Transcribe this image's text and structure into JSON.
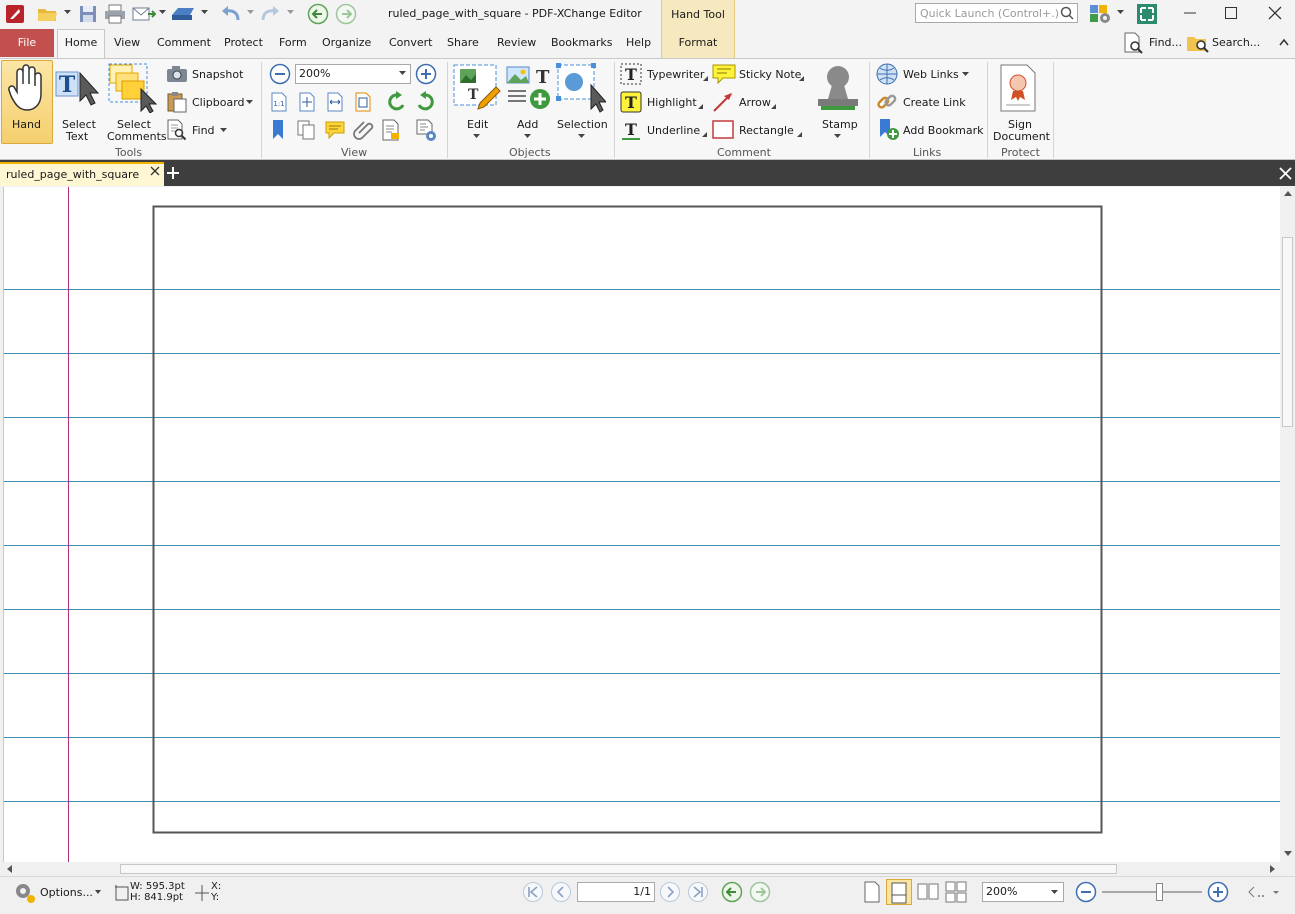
{
  "titlebar": {
    "title": "ruled_page_with_square - PDF-XChange Editor",
    "context_tab": "Hand Tool",
    "quick_launch_placeholder": "Quick Launch (Control+.)"
  },
  "menu": {
    "file": "File",
    "tabs": [
      "Home",
      "View",
      "Comment",
      "Protect",
      "Form",
      "Organize",
      "Convert",
      "Share",
      "Review",
      "Bookmarks",
      "Help"
    ],
    "context_format": "Format",
    "find": "Find...",
    "search": "Search..."
  },
  "ribbon": {
    "tools": {
      "group": "Tools",
      "hand": "Hand",
      "select_text_1": "Select",
      "select_text_2": "Text",
      "select_comments_1": "Select",
      "select_comments_2": "Comments",
      "snapshot": "Snapshot",
      "clipboard": "Clipboard",
      "find": "Find"
    },
    "view": {
      "group": "View",
      "zoom": "200%"
    },
    "objects": {
      "group": "Objects",
      "edit": "Edit",
      "add": "Add",
      "selection": "Selection"
    },
    "comment": {
      "group": "Comment",
      "typewriter": "Typewriter",
      "sticky_note": "Sticky Note",
      "highlight": "Highlight",
      "arrow": "Arrow",
      "underline": "Underline",
      "rectangle": "Rectangle",
      "stamp": "Stamp"
    },
    "links": {
      "group": "Links",
      "web_links": "Web Links",
      "create_link": "Create Link",
      "add_bookmark": "Add Bookmark"
    },
    "protect": {
      "group": "Protect",
      "sign_1": "Sign",
      "sign_2": "Document"
    }
  },
  "document": {
    "tab_title": "ruled_page_with_square"
  },
  "status": {
    "options": "Options...",
    "width": "W: 595.3pt",
    "height": "H: 841.9pt",
    "x": "X:",
    "y": "Y:",
    "page": "1/1",
    "zoom": "200%"
  },
  "colors": {
    "file_tab": "#c1504e",
    "context_tab": "#f7e9bf",
    "ruled_line": "#3d8fb4",
    "margin_line": "#b0307a",
    "square_border": "#555555"
  }
}
